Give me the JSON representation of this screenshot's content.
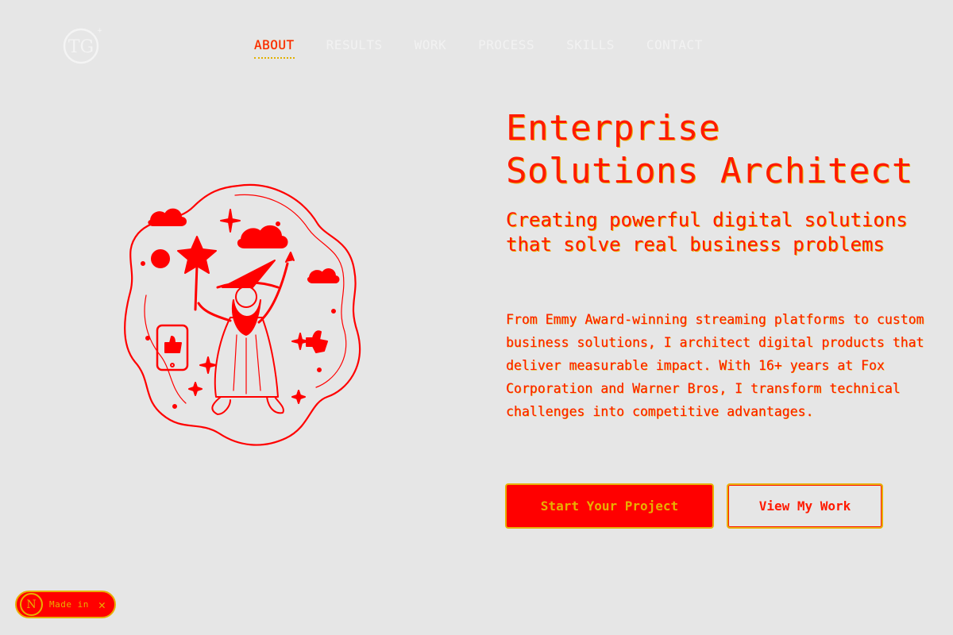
{
  "logo": {
    "text": "TG"
  },
  "nav": {
    "items": [
      {
        "label": "ABOUT",
        "active": true
      },
      {
        "label": "RESULTS",
        "active": false
      },
      {
        "label": "WORK",
        "active": false
      },
      {
        "label": "PROCESS",
        "active": false
      },
      {
        "label": "SKILLS",
        "active": false
      },
      {
        "label": "CONTACT",
        "active": false
      }
    ]
  },
  "hero": {
    "title_line1": "Enterprise",
    "title_line2": "Solutions Architect",
    "tagline": "Creating powerful digital solutions that solve real business problems",
    "body": "From Emmy Award-winning streaming platforms to custom business solutions, I architect digital products that deliver measurable impact. With 16+ years at Fox Corporation and Warner Bros, I transform technical challenges into competitive advantages.",
    "primary_cta": "Start Your Project",
    "secondary_cta": "View My Work"
  },
  "badge": {
    "logo_text": "N",
    "label": "Made in",
    "close_symbol": "✕"
  },
  "colors": {
    "background": "#e6e6e6",
    "accent": "#ff0000",
    "outline": "#e8b000"
  }
}
